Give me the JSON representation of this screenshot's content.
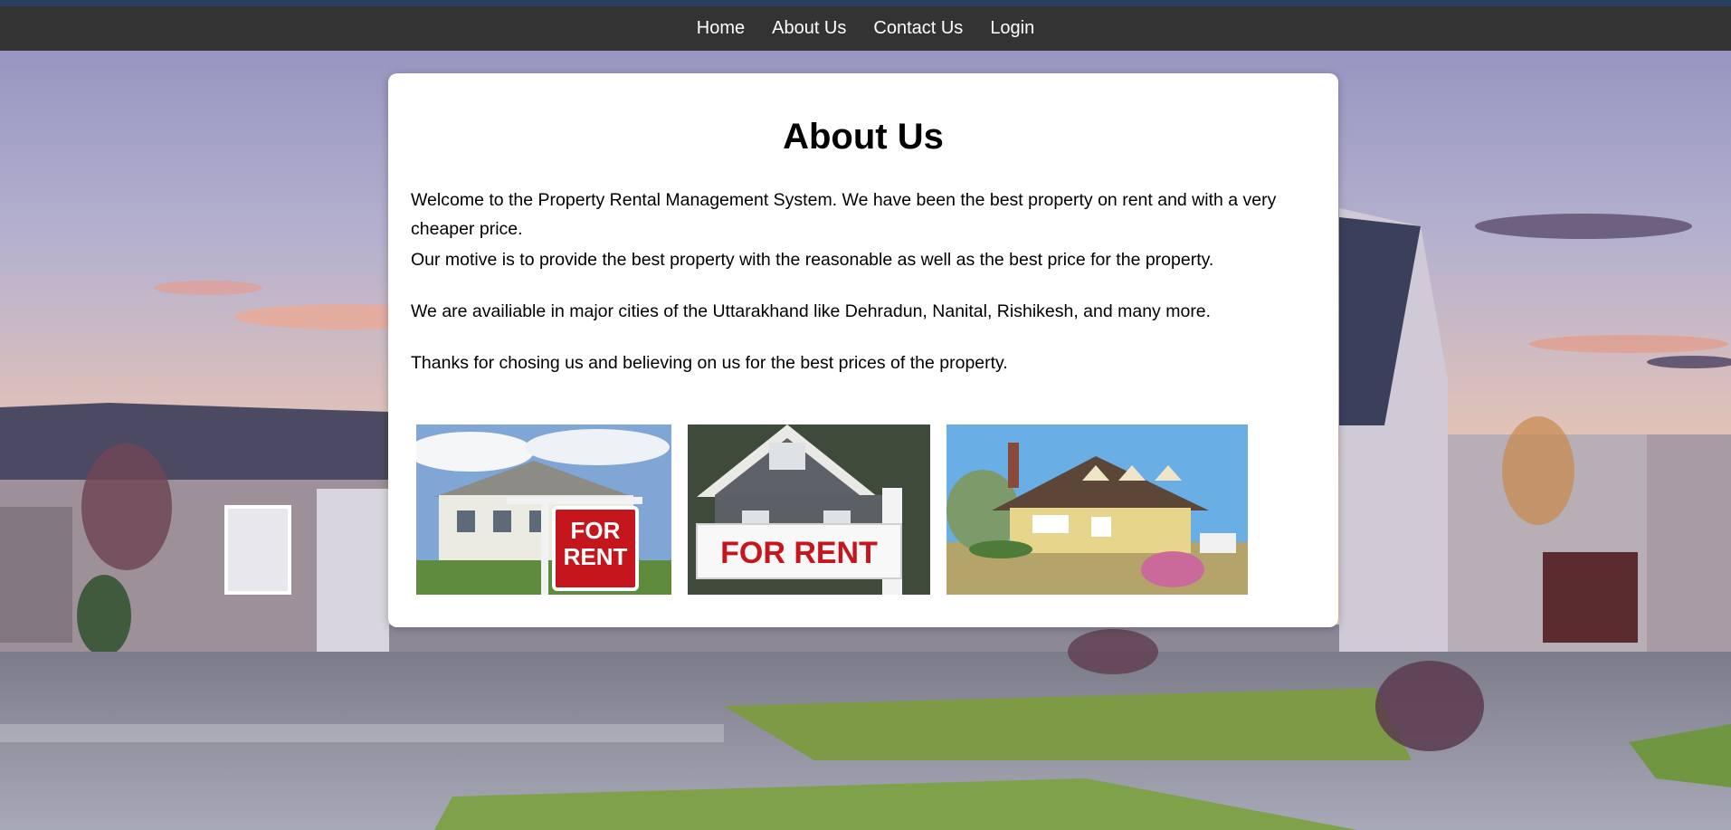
{
  "nav": {
    "items": [
      "Home",
      "About Us",
      "Contact Us",
      "Login"
    ]
  },
  "about": {
    "title": "About Us",
    "paragraphs": [
      "Welcome to the Property Rental Management System. We have been the best property on rent and with a very cheaper price.",
      "Our motive is to provide the best property with the reasonable as well as the best price for the property.",
      "We are availiable in major cities of the Uttarakhand like Dehradun, Nanital, Rishikesh, and many more.",
      "Thanks for chosing us and believing on us for the best prices of the property."
    ]
  },
  "gallery": {
    "photo1_sign": [
      "FOR",
      "RENT"
    ],
    "photo2_sign": "FOR RENT"
  },
  "colors": {
    "navbar": "#333333",
    "topline": "#2b3f63",
    "card": "#ffffff",
    "sign_red": "#c4161c"
  }
}
